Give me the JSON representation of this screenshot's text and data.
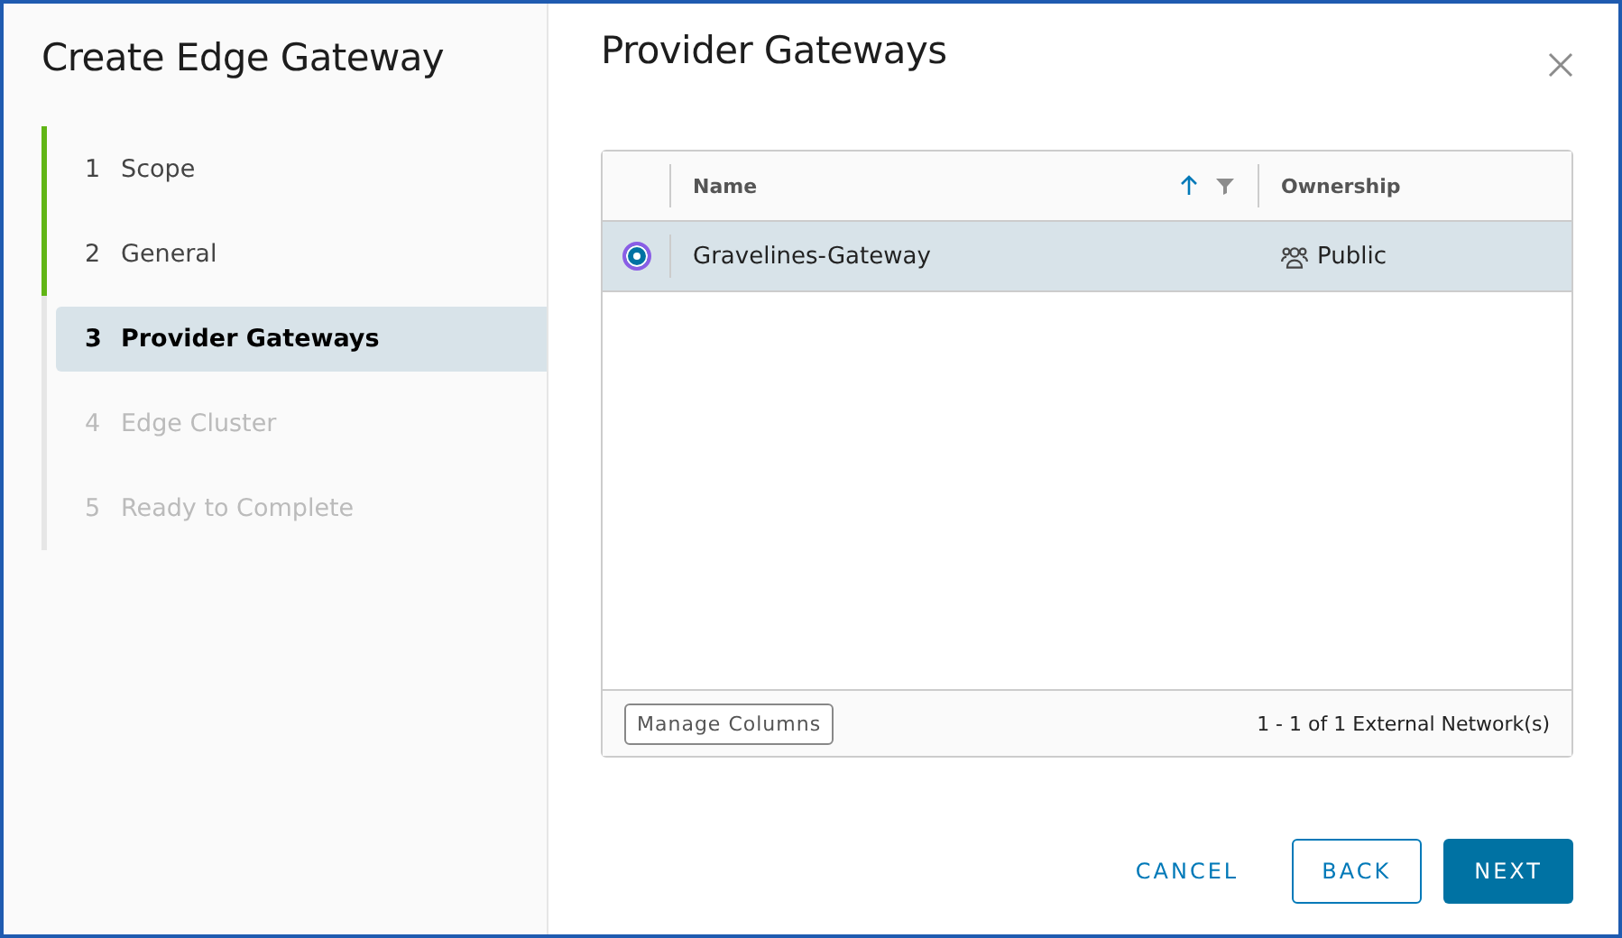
{
  "wizard": {
    "title": "Create Edge Gateway"
  },
  "steps": [
    {
      "number": "1",
      "label": "Scope",
      "completed": true,
      "selected": false,
      "disabled": false
    },
    {
      "number": "2",
      "label": "General",
      "completed": true,
      "selected": false,
      "disabled": false
    },
    {
      "number": "3",
      "label": "Provider Gateways",
      "completed": false,
      "selected": true,
      "disabled": false
    },
    {
      "number": "4",
      "label": "Edge Cluster",
      "completed": false,
      "selected": false,
      "disabled": true
    },
    {
      "number": "5",
      "label": "Ready to Complete",
      "completed": false,
      "selected": false,
      "disabled": true
    }
  ],
  "page": {
    "title": "Provider Gateways"
  },
  "table": {
    "columns": [
      {
        "label": "Name",
        "sorted": true,
        "filterable": true
      },
      {
        "label": "Ownership",
        "sorted": false,
        "filterable": false
      }
    ],
    "rows": [
      {
        "name": "Gravelines-Gateway",
        "ownership": "Public",
        "selected": true
      }
    ],
    "footer": {
      "manage_button": "Manage Columns",
      "count": "1 - 1 of 1 External Network(s)"
    }
  },
  "buttons": [
    {
      "label": "CANCEL",
      "kind": "link"
    },
    {
      "label": "BACK",
      "kind": "outline"
    },
    {
      "label": "NEXT",
      "kind": "primary"
    }
  ]
}
